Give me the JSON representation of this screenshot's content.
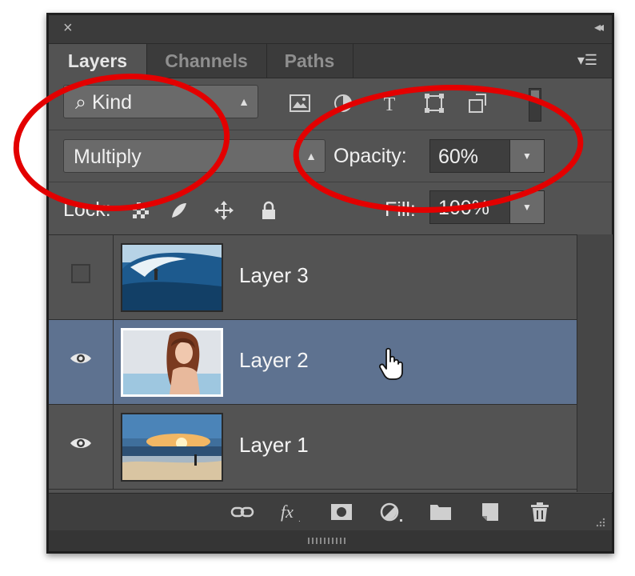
{
  "window": {
    "close_glyph": "×",
    "collapse_glyph": "◂◂"
  },
  "tabs": [
    {
      "label": "Layers",
      "active": true
    },
    {
      "label": "Channels",
      "active": false
    },
    {
      "label": "Paths",
      "active": false
    }
  ],
  "filter": {
    "kind_label": "Kind",
    "icons": [
      "pixel-layer-filter-icon",
      "adjustment-layer-filter-icon",
      "type-layer-filter-icon",
      "shape-layer-filter-icon",
      "smart-object-filter-icon"
    ]
  },
  "blend": {
    "mode": "Multiply",
    "opacity_label": "Opacity:",
    "opacity_value": "60%"
  },
  "lock": {
    "label": "Lock:",
    "fill_label": "Fill:",
    "fill_value": "100%",
    "icons": [
      "lock-transparent-pixels-icon",
      "lock-image-pixels-icon",
      "lock-position-icon",
      "lock-all-icon"
    ]
  },
  "layers": [
    {
      "name": "Layer 3",
      "visible": false,
      "selected": false,
      "thumb": "surfer-wave"
    },
    {
      "name": "Layer 2",
      "visible": true,
      "selected": true,
      "thumb": "woman-portrait"
    },
    {
      "name": "Layer 1",
      "visible": true,
      "selected": false,
      "thumb": "beach-sunset"
    }
  ],
  "footer_icons": [
    "link-layers-icon",
    "layer-style-fx-icon",
    "add-mask-icon",
    "adjustment-layer-icon",
    "new-group-icon",
    "new-layer-icon",
    "delete-layer-icon"
  ],
  "colors": {
    "panel": "#535353",
    "selected_row": "#5e7290",
    "annotation_circle": "#e30000"
  }
}
